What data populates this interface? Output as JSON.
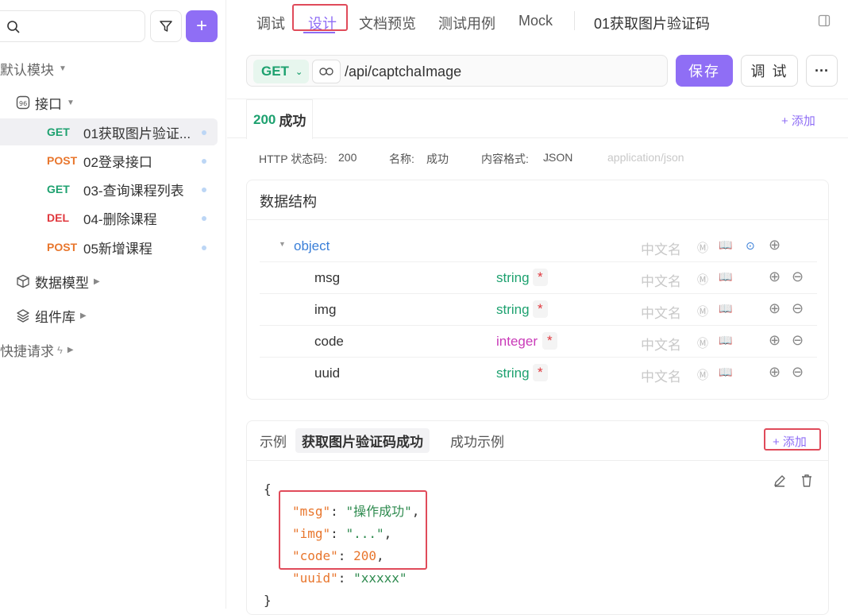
{
  "sidebar": {
    "search_placeholder": "",
    "folders": {
      "default_module": "默认模块",
      "interfaces": "接口",
      "data_models": "数据模型",
      "components": "组件库",
      "quick_requests": "快捷请求"
    },
    "apis": [
      {
        "method": "GET",
        "name": "01获取图片验证..."
      },
      {
        "method": "POST",
        "name": "02登录接口"
      },
      {
        "method": "GET",
        "name": "03-查询课程列表"
      },
      {
        "method": "DEL",
        "name": "04-删除课程"
      },
      {
        "method": "POST",
        "name": "05新增课程"
      }
    ]
  },
  "tabs": [
    "调试",
    "设计",
    "文档预览",
    "测试用例",
    "Mock"
  ],
  "active_tab": "设计",
  "page_title": "01获取图片验证码",
  "request": {
    "method": "GET",
    "url": "/api/captchaImage",
    "save_label": "保存",
    "debug_label": "调 试"
  },
  "response": {
    "tab_code": "200",
    "tab_label": "成功",
    "add_label": "+ 添加",
    "meta": {
      "status_label": "HTTP 状态码:",
      "status_value": "200",
      "name_label": "名称:",
      "name_value": "成功",
      "format_label": "内容格式:",
      "format_value": "JSON",
      "mime": "application/json"
    }
  },
  "schema": {
    "title": "数据结构",
    "root_type": "object",
    "cn_placeholder": "中文名",
    "fields": [
      {
        "name": "msg",
        "type": "string"
      },
      {
        "name": "img",
        "type": "string"
      },
      {
        "name": "code",
        "type": "integer"
      },
      {
        "name": "uuid",
        "type": "string"
      }
    ]
  },
  "examples": {
    "label": "示例",
    "active": "获取图片验证码成功",
    "other": "成功示例",
    "add_label": "+ 添加",
    "code": {
      "open": "{",
      "close": "}",
      "lines": [
        {
          "key": "\"msg\"",
          "value": "\"操作成功\"",
          "kind": "s"
        },
        {
          "key": "\"img\"",
          "value": "\"...\"",
          "kind": "s"
        },
        {
          "key": "\"code\"",
          "value": "200",
          "kind": "n"
        },
        {
          "key": "\"uuid\"",
          "value": "\"xxxxx\"",
          "kind": "s"
        }
      ]
    }
  }
}
